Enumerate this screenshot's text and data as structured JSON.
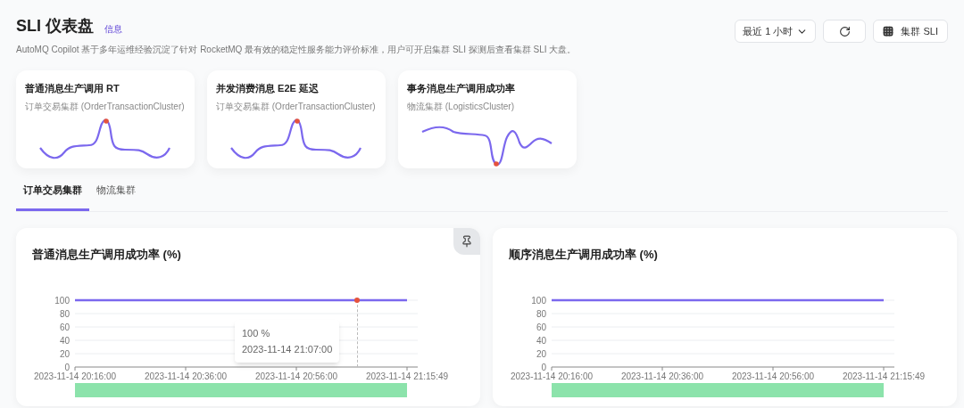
{
  "header": {
    "title": "SLI 仪表盘",
    "info_link": "信息",
    "description": "AutoMQ Copilot 基于多年运维经验沉淀了针对 RocketMQ 最有效的稳定性服务能力评价标准，用户可开启集群 SLI 探测后查看集群 SLI 大盘。"
  },
  "toolbar": {
    "time_range": "最近 1 小时",
    "cluster_button": "集群 SLI"
  },
  "summary_cards": [
    {
      "title": "普通消息生产调用 RT",
      "cluster": "订单交易集群 (OrderTransactionCluster)",
      "kind": "peak"
    },
    {
      "title": "并发消费消息 E2E 延迟",
      "cluster": "订单交易集群 (OrderTransactionCluster)",
      "kind": "peak"
    },
    {
      "title": "事务消息生产调用成功率",
      "cluster": "物流集群 (LogisticsCluster)",
      "kind": "dip"
    }
  ],
  "tabs": [
    {
      "label": "订单交易集群",
      "selected": true
    },
    {
      "label": "物流集群",
      "selected": false
    }
  ],
  "charts": [
    {
      "title": "普通消息生产调用成功率 (%)",
      "pinned": true,
      "tooltip": {
        "value": "100 %",
        "time": "2023-11-14 21:07:00"
      },
      "chart_data": {
        "type": "line",
        "categories": [
          "2023-11-14 20:16:00",
          "2023-11-14 20:36:00",
          "2023-11-14 20:56:00",
          "2023-11-14 21:15:49"
        ],
        "series": [
          {
            "color": "#7b68ee",
            "values": [
              100,
              100,
              100,
              100
            ]
          }
        ],
        "ylim": [
          0,
          100
        ],
        "yticks": [
          0,
          20,
          40,
          60,
          80,
          100
        ],
        "grid": true
      }
    },
    {
      "title": "顺序消息生产调用成功率 (%)",
      "chart_data": {
        "type": "line",
        "categories": [
          "2023-11-14 20:16:00",
          "2023-11-14 20:36:00",
          "2023-11-14 20:56:00",
          "2023-11-14 21:15:49"
        ],
        "series": [
          {
            "color": "#7b68ee",
            "values": [
              100,
              100,
              100,
              100
            ]
          }
        ],
        "ylim": [
          0,
          100
        ],
        "yticks": [
          0,
          20,
          40,
          60,
          80,
          100
        ],
        "grid": true
      }
    }
  ]
}
